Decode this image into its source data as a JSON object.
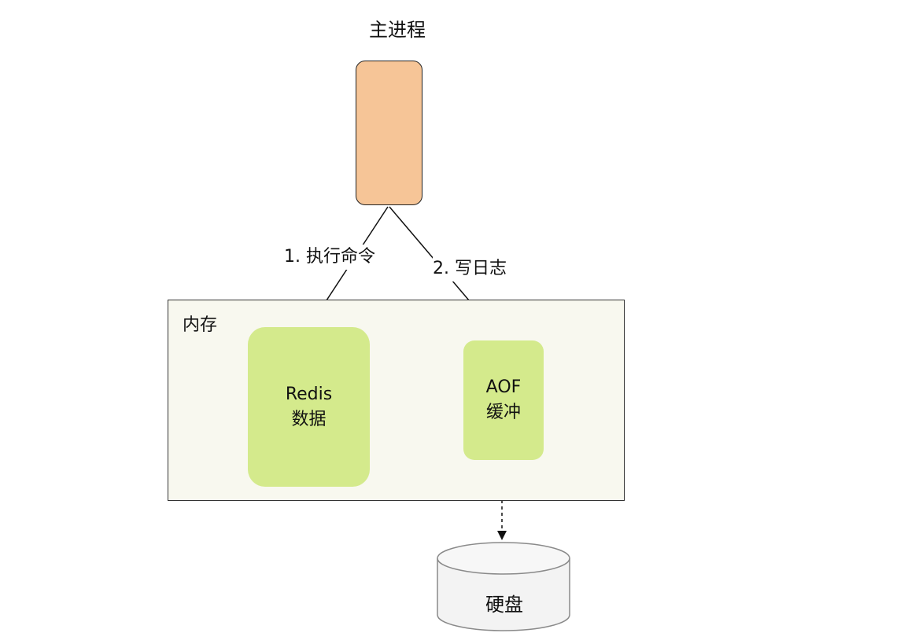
{
  "process": {
    "title": "主进程"
  },
  "memory": {
    "label": "内存"
  },
  "redis_node": {
    "line1": "Redis",
    "line2": "数据"
  },
  "aof_node": {
    "line1": "AOF",
    "line2": "缓冲"
  },
  "edges": {
    "execute_label": "1. 执行命令",
    "write_log_label": "2. 写日志"
  },
  "disk": {
    "label": "硬盘"
  },
  "colors": {
    "process_fill": "#f6c597",
    "memory_fill": "#f8f8ef",
    "node_fill": "#d4ea8c",
    "disk_fill": "#f3f3f3"
  }
}
